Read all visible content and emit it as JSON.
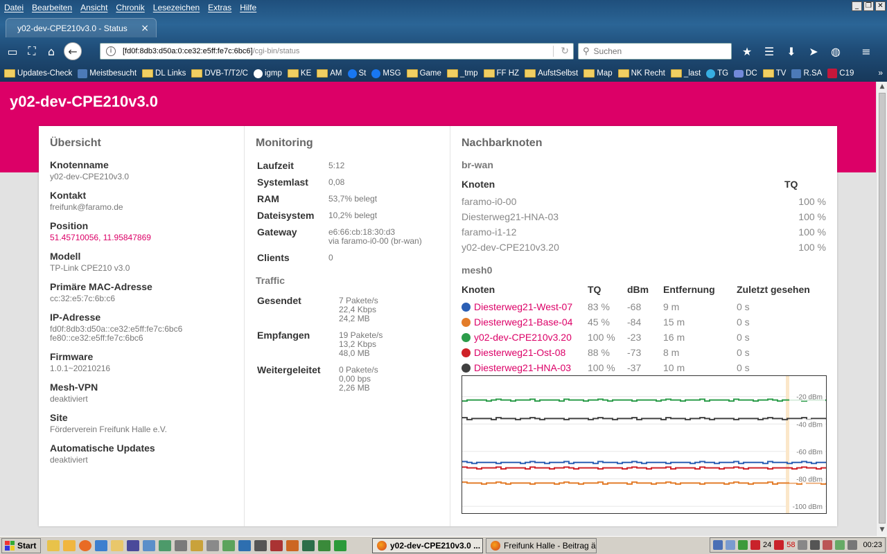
{
  "browser": {
    "menu": [
      "Datei",
      "Bearbeiten",
      "Ansicht",
      "Chronik",
      "Lesezeichen",
      "Extras",
      "Hilfe"
    ],
    "tab_title": "y02-dev-CPE210v3.0 - Status",
    "url_host": "[fd0f:8db3:d50a:0:ce32:e5ff:fe7c:6bc6]",
    "url_path": "/cgi-bin/status",
    "search_placeholder": "Suchen",
    "bookmarks": [
      {
        "label": "Updates-Check",
        "icon": "folder-icon"
      },
      {
        "label": "Meistbesucht",
        "icon": "site-icon"
      },
      {
        "label": "DL Links",
        "icon": "folder-icon"
      },
      {
        "label": "DVB-T/T2/C",
        "icon": "folder-icon"
      },
      {
        "label": "igmp",
        "icon": "google-icon"
      },
      {
        "label": "KE",
        "icon": "folder-icon"
      },
      {
        "label": "AM",
        "icon": "folder-icon"
      },
      {
        "label": "St",
        "icon": "facebook-icon"
      },
      {
        "label": "MSG",
        "icon": "facebook-icon"
      },
      {
        "label": "Game",
        "icon": "folder-icon"
      },
      {
        "label": "_tmp",
        "icon": "folder-icon"
      },
      {
        "label": "FF HZ",
        "icon": "folder-icon"
      },
      {
        "label": "AufstSelbst",
        "icon": "folder-icon"
      },
      {
        "label": "Map",
        "icon": "folder-icon"
      },
      {
        "label": "NK Recht",
        "icon": "folder-icon"
      },
      {
        "label": "_last",
        "icon": "folder-icon"
      },
      {
        "label": "TG",
        "icon": "telegram-icon"
      },
      {
        "label": "DC",
        "icon": "discord-icon"
      },
      {
        "label": "TV",
        "icon": "folder-icon"
      },
      {
        "label": "R.SA",
        "icon": "site-icon"
      },
      {
        "label": "C19",
        "icon": "red-site-icon"
      }
    ]
  },
  "page": {
    "title": "y02-dev-CPE210v3.0",
    "overview": {
      "heading": "Übersicht",
      "items": [
        {
          "label": "Knotenname",
          "values": [
            "y02-dev-CPE210v3.0"
          ],
          "link": false
        },
        {
          "label": "Kontakt",
          "values": [
            "freifunk@faramo.de"
          ],
          "link": false
        },
        {
          "label": "Position",
          "values": [
            "51.45710056, 11.95847869"
          ],
          "link": true
        },
        {
          "label": "Modell",
          "values": [
            "TP-Link CPE210 v3.0"
          ],
          "link": false
        },
        {
          "label": "Primäre MAC-Adresse",
          "values": [
            "cc:32:e5:7c:6b:c6"
          ],
          "link": false
        },
        {
          "label": "IP-Adresse",
          "values": [
            "fd0f:8db3:d50a::ce32:e5ff:fe7c:6bc6",
            "fe80::ce32:e5ff:fe7c:6bc6"
          ],
          "link": false
        },
        {
          "label": "Firmware",
          "values": [
            "1.0.1~20210216"
          ],
          "link": false
        },
        {
          "label": "Mesh-VPN",
          "values": [
            "deaktiviert"
          ],
          "link": false
        },
        {
          "label": "Site",
          "values": [
            "Förderverein Freifunk Halle e.V."
          ],
          "link": false
        },
        {
          "label": "Automatische Updates",
          "values": [
            "deaktiviert"
          ],
          "link": false
        }
      ]
    },
    "monitoring": {
      "heading": "Monitoring",
      "rows": [
        {
          "label": "Laufzeit",
          "values": [
            "5:12"
          ]
        },
        {
          "label": "Systemlast",
          "values": [
            "0,08"
          ]
        },
        {
          "label": "RAM",
          "values": [
            "53,7% belegt"
          ]
        },
        {
          "label": "Dateisystem",
          "values": [
            "10,2% belegt"
          ]
        },
        {
          "label": "Gateway",
          "values": [
            "e6:66:cb:18:30:d3",
            "via faramo-i0-00 (br-wan)"
          ]
        },
        {
          "label": "Clients",
          "values": [
            "0"
          ]
        }
      ],
      "traffic_heading": "Traffic",
      "traffic": [
        {
          "label": "Gesendet",
          "values": [
            "7 Pakete/s",
            "22,4 Kbps",
            "24,2 MB"
          ]
        },
        {
          "label": "Empfangen",
          "values": [
            "19 Pakete/s",
            "13,2 Kbps",
            "48,0 MB"
          ]
        },
        {
          "label": "Weitergeleitet",
          "values": [
            "0 Pakete/s",
            "0,00 bps",
            "2,26 MB"
          ]
        }
      ]
    },
    "neighbours": {
      "heading": "Nachbarknoten",
      "brwan": {
        "name": "br-wan",
        "col_node": "Knoten",
        "col_tq": "TQ",
        "rows": [
          {
            "node": "faramo-i0-00",
            "tq": "100 %"
          },
          {
            "node": "Diesterweg21-HNA-03",
            "tq": "100 %"
          },
          {
            "node": "faramo-i1-12",
            "tq": "100 %"
          },
          {
            "node": "y02-dev-CPE210v3.20",
            "tq": "100 %"
          }
        ]
      },
      "mesh0": {
        "name": "mesh0",
        "columns": [
          "Knoten",
          "TQ",
          "dBm",
          "Entfernung",
          "Zuletzt gesehen"
        ],
        "rows": [
          {
            "node": "Diesterweg21-West-07",
            "tq": "83 %",
            "dbm": "-68",
            "dist": "9 m",
            "seen": "0 s",
            "color": "#2b5fb4"
          },
          {
            "node": "Diesterweg21-Base-04",
            "tq": "45 %",
            "dbm": "-84",
            "dist": "15 m",
            "seen": "0 s",
            "color": "#e37c29"
          },
          {
            "node": "y02-dev-CPE210v3.20",
            "tq": "100 %",
            "dbm": "-23",
            "dist": "16 m",
            "seen": "0 s",
            "color": "#2c9c4a"
          },
          {
            "node": "Diesterweg21-Ost-08",
            "tq": "88 %",
            "dbm": "-73",
            "dist": "8 m",
            "seen": "0 s",
            "color": "#cf2228"
          },
          {
            "node": "Diesterweg21-HNA-03",
            "tq": "100 %",
            "dbm": "-37",
            "dist": "10 m",
            "seen": "0 s",
            "color": "#404040"
          }
        ]
      }
    }
  },
  "chart_data": {
    "type": "line",
    "ylim": [
      -105,
      -5
    ],
    "y_ticks": [
      -20,
      -40,
      -60,
      -80,
      -100
    ],
    "tick_labels": [
      "-20 dBm",
      "-40 dBm",
      "-60 dBm",
      "-80 dBm",
      "-100 dBm"
    ],
    "series": [
      {
        "name": "y02-dev-CPE210v3.20",
        "value": -22.5,
        "color": "#2c9c4a"
      },
      {
        "name": "Diesterweg21-HNA-03",
        "value": -36,
        "color": "#404040"
      },
      {
        "name": "Diesterweg21-West-07",
        "value": -68,
        "color": "#2b5fb4"
      },
      {
        "name": "Diesterweg21-Ost-08",
        "value": -72,
        "color": "#cf2228"
      },
      {
        "name": "Diesterweg21-Base-04",
        "value": -83,
        "color": "#e37c29"
      }
    ]
  },
  "taskbar": {
    "start": "Start",
    "tasks": [
      "y02-dev-CPE210v3.0 ...",
      "Freifunk Halle - Beitrag ä..."
    ],
    "tray_num1": "24",
    "tray_num2": "58",
    "clock": "00:23"
  }
}
